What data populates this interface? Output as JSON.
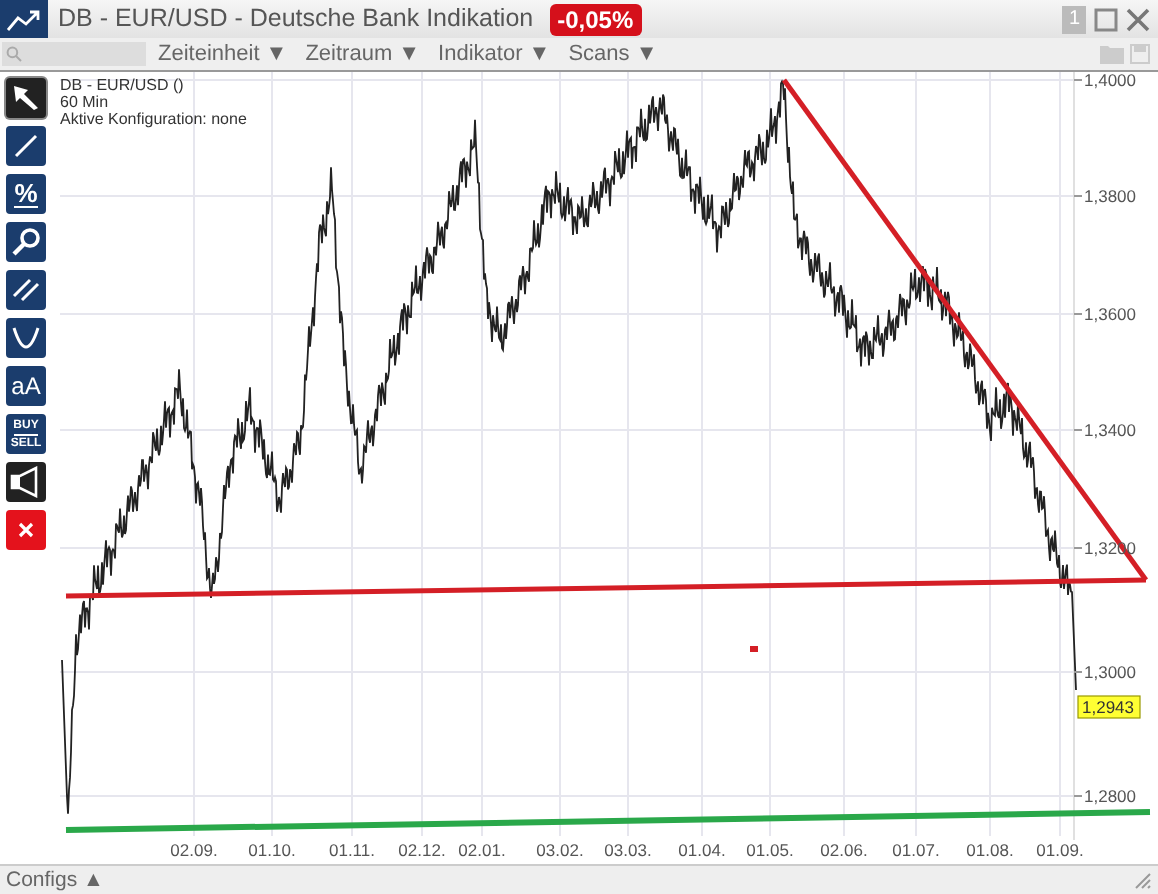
{
  "window": {
    "title": "DB - EUR/USD - Deutsche Bank Indikation",
    "change": "-0,05%",
    "panel_number": "1"
  },
  "toolbar": {
    "menus": [
      "Zeiteinheit ▼",
      "Zeitraum ▼",
      "Indikator ▼",
      "Scans ▼"
    ]
  },
  "tools": [
    {
      "kind": "pointer",
      "selected": true
    },
    {
      "kind": "line",
      "selected": false
    },
    {
      "kind": "percent",
      "label": "%",
      "selected": false
    },
    {
      "kind": "zoom",
      "selected": false
    },
    {
      "kind": "parallel",
      "selected": false
    },
    {
      "kind": "curve",
      "selected": false
    },
    {
      "kind": "text",
      "label": "aA",
      "selected": false
    },
    {
      "kind": "trade",
      "label": "BUY",
      "sublabel": "SELL",
      "selected": false
    },
    {
      "kind": "alert",
      "selected": false
    },
    {
      "kind": "delete",
      "selected": false
    }
  ],
  "chart": {
    "legend": [
      "DB - EUR/USD ()",
      "60 Min",
      "Aktive Konfiguration: none"
    ],
    "yticks": [
      "1,4000",
      "1,3800",
      "1,3600",
      "1,3400",
      "1,3200",
      "1,3000",
      "1,2800"
    ],
    "xticks": [
      "02.09.",
      "01.10.",
      "01.11.",
      "02.12.",
      "02.01.",
      "03.02.",
      "03.03.",
      "01.04.",
      "01.05.",
      "02.06.",
      "01.07.",
      "01.08.",
      "01.09."
    ],
    "last_price": "1,2943"
  },
  "footer": {
    "configs": "Configs ▲"
  }
}
